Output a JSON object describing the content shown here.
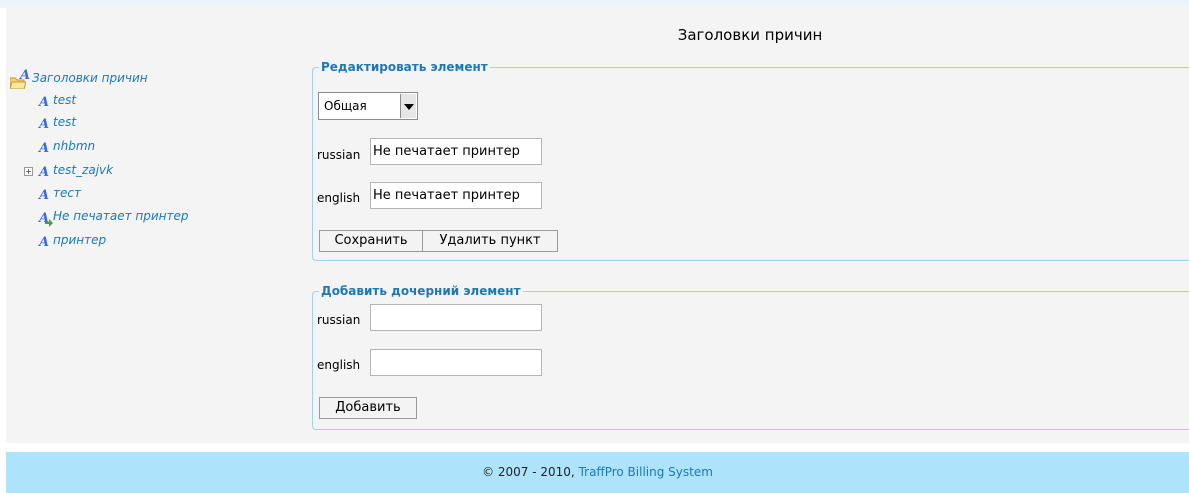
{
  "page": {
    "title": "Заголовки причин"
  },
  "tree": {
    "root_label": "Заголовки причин",
    "items": [
      {
        "label": "test"
      },
      {
        "label": "test"
      },
      {
        "label": "nhbmn"
      },
      {
        "label": "test_zajvk",
        "expander": "+"
      },
      {
        "label": "тест"
      },
      {
        "label": "Не печатает принтер",
        "selected": true
      },
      {
        "label": "принтер"
      }
    ]
  },
  "edit": {
    "legend": "Редактировать элемент",
    "category_selected": "Общая",
    "russian_label": "russian",
    "russian_value": "Не печатает принтер",
    "english_label": "english",
    "english_value": "Не печатает принтер",
    "save_label": "Сохранить",
    "delete_label": "Удалить пункт"
  },
  "add": {
    "legend": "Добавить дочерний элемент",
    "russian_label": "russian",
    "russian_value": "",
    "english_label": "english",
    "english_value": "",
    "add_label": "Добавить"
  },
  "footer": {
    "copyright": "© 2007 - 2010,",
    "link": "TraffPro Billing System"
  },
  "colors": {
    "link": "#1f78b4",
    "footer_bg": "#aee4fb",
    "border": "#a7cfe6"
  }
}
